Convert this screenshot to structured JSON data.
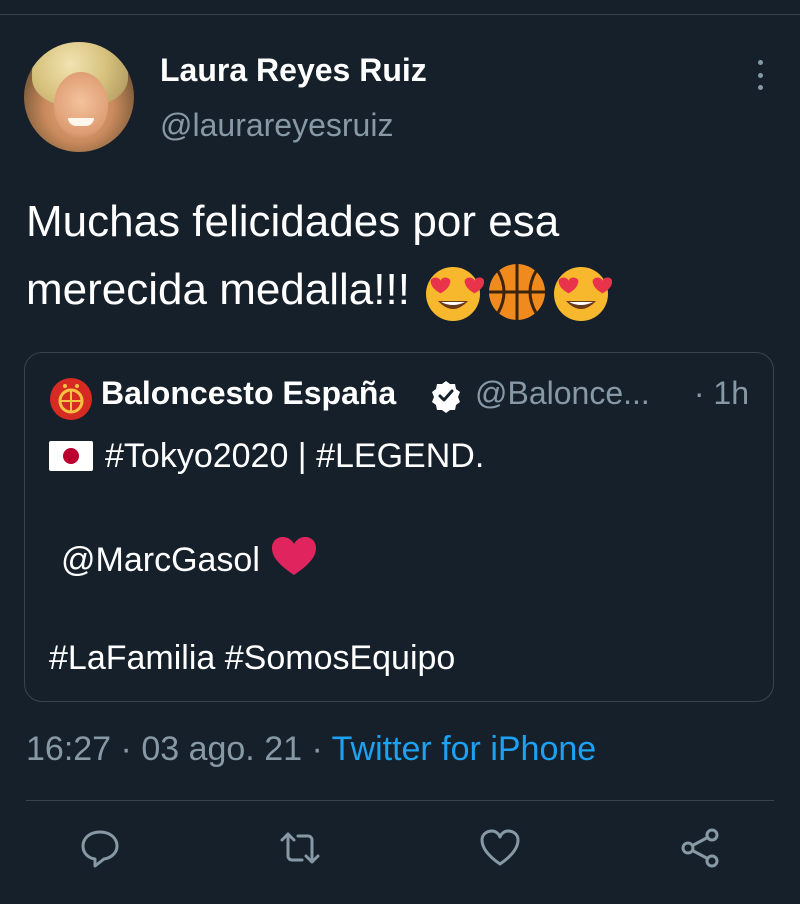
{
  "author": {
    "name": "Laura Reyes Ruiz",
    "handle": "@laurareyesruiz"
  },
  "tweet": {
    "line1": "Muchas felicidades por esa",
    "line2": "merecida medalla!!!",
    "emojis": [
      "heart-eyes-emoji",
      "basketball-emoji",
      "heart-eyes-emoji"
    ]
  },
  "quote": {
    "name": "Baloncesto España",
    "handle": "@Balonce...",
    "time": "· 1h",
    "line1": "#Tokyo2020 | #LEGEND.",
    "line2": "@MarcGasol",
    "line3": "#LaFamilia #SomosEquipo"
  },
  "meta": {
    "time": "16:27",
    "sep1": " · ",
    "date": "03 ago. 21",
    "sep2": " · ",
    "source": "Twitter for iPhone"
  },
  "actions": [
    "reply-icon",
    "retweet-icon",
    "like-icon",
    "share-icon"
  ],
  "colors": {
    "background": "#15202b",
    "secondary_text": "#8899a6",
    "link": "#1da1f2",
    "border": "#38444d"
  }
}
